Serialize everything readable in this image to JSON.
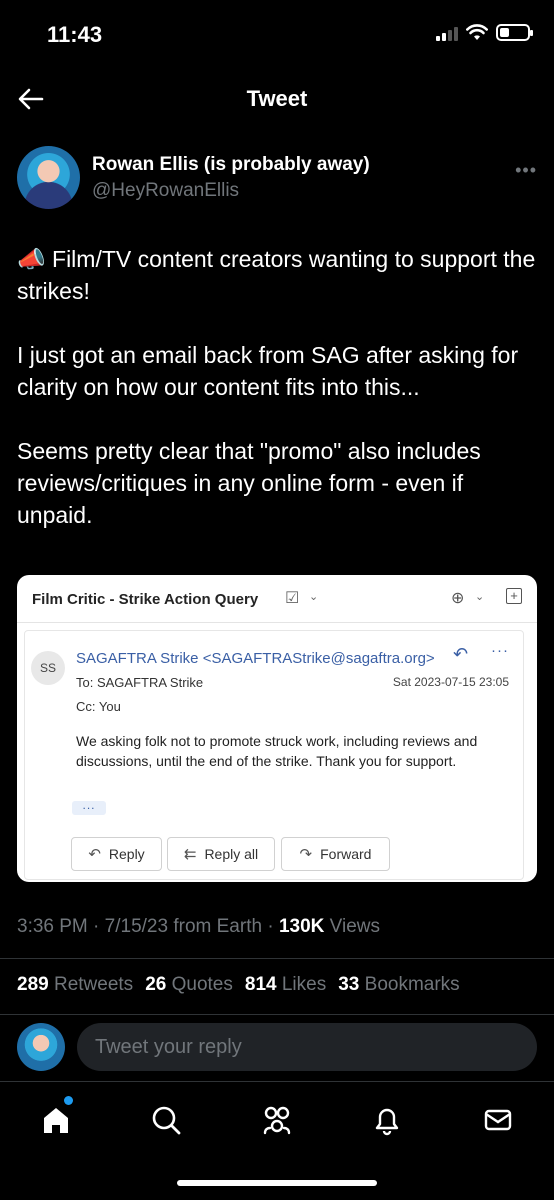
{
  "status_bar": {
    "time": "11:43"
  },
  "header": {
    "title": "Tweet"
  },
  "author": {
    "display_name": "Rowan Ellis (is probably away)",
    "handle": "@HeyRowanEllis"
  },
  "tweet": {
    "text": "📣 Film/TV content creators wanting to support the strikes!\n\nI just got an email back from SAG after asking for clarity on how our content fits into this...\n\nSeems pretty clear that \"promo\" also includes reviews/critiques in any online form - even if unpaid."
  },
  "email": {
    "subject": "Film Critic - Strike Action Query",
    "sender_initials": "SS",
    "sender": "SAGAFTRA Strike <SAGAFTRAStrike@sagaftra.org>",
    "to": "To:  SAGAFTRA Strike",
    "cc": "Cc:  You",
    "date": "Sat 2023-07-15 23:05",
    "message": "We asking folk not to promote struck work, including reviews and discussions, until the end of the strike.  Thank you for support.",
    "ellipsis": "...",
    "actions": {
      "reply": "Reply",
      "reply_all": "Reply all",
      "forward": "Forward"
    }
  },
  "meta": {
    "time": "3:36 PM",
    "date": "7/15/23",
    "source": "from Earth",
    "views_count": "130K",
    "views_label": "Views"
  },
  "stats": {
    "retweets_count": "289",
    "retweets_label": "Retweets",
    "quotes_count": "26",
    "quotes_label": "Quotes",
    "likes_count": "814",
    "likes_label": "Likes",
    "bookmarks_count": "33",
    "bookmarks_label": "Bookmarks"
  },
  "reply": {
    "placeholder": "Tweet your reply"
  },
  "tabs": [
    "home-icon",
    "search-icon",
    "communities-icon",
    "notifications-icon",
    "messages-icon"
  ],
  "colors": {
    "accent": "#1d9bf0",
    "muted": "#71767b",
    "link": "#3a5fa5"
  }
}
